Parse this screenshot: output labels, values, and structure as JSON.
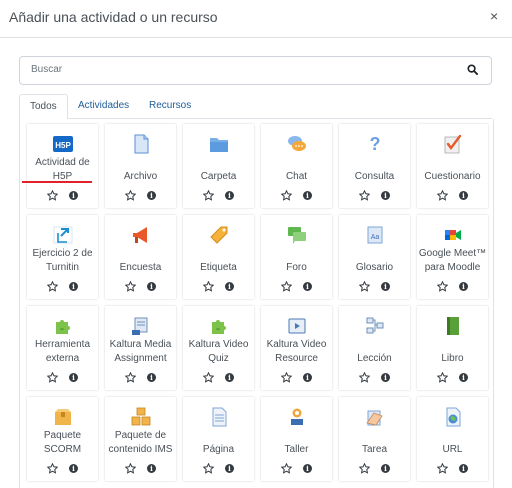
{
  "dialog": {
    "title": "Añadir una actividad o un recurso",
    "close": "×"
  },
  "search": {
    "placeholder": "Buscar"
  },
  "tabs": [
    {
      "label": "Todos",
      "active": true
    },
    {
      "label": "Actividades",
      "active": false
    },
    {
      "label": "Recursos",
      "active": false
    }
  ],
  "info_glyph": "i",
  "items": [
    {
      "label": "Actividad de H5P",
      "icon": "h5p-icon"
    },
    {
      "label": "Archivo",
      "icon": "file-icon"
    },
    {
      "label": "Carpeta",
      "icon": "folder-icon"
    },
    {
      "label": "Chat",
      "icon": "chat-icon"
    },
    {
      "label": "Consulta",
      "icon": "question-icon"
    },
    {
      "label": "Cuestionario",
      "icon": "quiz-icon"
    },
    {
      "label": "Ejercicio 2 de Turnitin",
      "icon": "turnitin-icon"
    },
    {
      "label": "Encuesta",
      "icon": "megaphone-icon"
    },
    {
      "label": "Etiqueta",
      "icon": "tag-icon"
    },
    {
      "label": "Foro",
      "icon": "forum-icon"
    },
    {
      "label": "Glosario",
      "icon": "glossary-icon"
    },
    {
      "label": "Google Meet™ para Moodle",
      "icon": "google-meet-icon"
    },
    {
      "label": "Herramienta externa",
      "icon": "puzzle-icon"
    },
    {
      "label": "Kaltura Media Assignment",
      "icon": "kaltura-assignment-icon"
    },
    {
      "label": "Kaltura Video Quiz",
      "icon": "puzzle-icon"
    },
    {
      "label": "Kaltura Video Resource",
      "icon": "video-player-icon"
    },
    {
      "label": "Lección",
      "icon": "lesson-icon"
    },
    {
      "label": "Libro",
      "icon": "book-icon"
    },
    {
      "label": "Paquete SCORM",
      "icon": "package-icon"
    },
    {
      "label": "Paquete de contenido IMS",
      "icon": "boxes-icon"
    },
    {
      "label": "Página",
      "icon": "page-icon"
    },
    {
      "label": "Taller",
      "icon": "workshop-icon"
    },
    {
      "label": "Tarea",
      "icon": "assignment-icon"
    },
    {
      "label": "URL",
      "icon": "url-icon"
    }
  ],
  "colors": {
    "link": "#1e5c99",
    "highlight_underline": "#e2222a",
    "text": "#495057"
  }
}
